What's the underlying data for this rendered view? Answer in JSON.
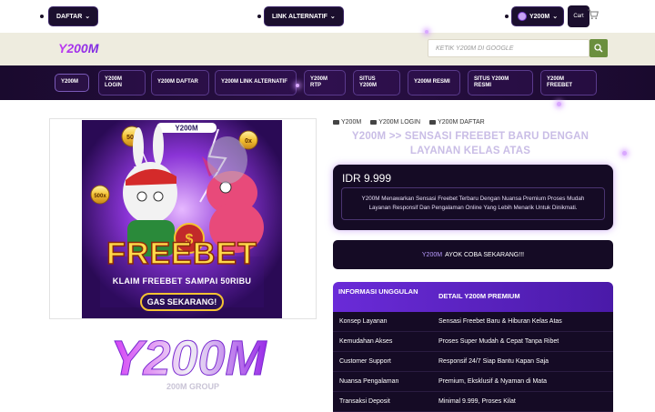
{
  "topbar": {
    "daftar_label": "DAFTAR",
    "link_alt_label": "LINK ALTERNATIF",
    "account_label": "Y200M",
    "cart_label": "Cart"
  },
  "header": {
    "logo_text": "Y200M",
    "search_placeholder": "KETIK Y200M DI GOOGLE"
  },
  "nav": {
    "items": [
      {
        "label": "Y200M"
      },
      {
        "label": "Y200M LOGIN"
      },
      {
        "label": "Y200M DAFTAR"
      },
      {
        "label": "Y200M LINK ALTERNATIF"
      },
      {
        "label": "Y200M RTP"
      },
      {
        "label": "SITUS Y200M"
      },
      {
        "label": "Y200M RESMI"
      },
      {
        "label": "SITUS Y200M RESMI"
      },
      {
        "label": "Y200M FREEBET"
      }
    ]
  },
  "banner": {
    "search_text": "Y200M",
    "multiplier_left": "50x",
    "multiplier_right": "0x",
    "multiplier_small": "500x",
    "title": "FREEBET",
    "subtitle": "KLAIM FREEBET SAMPAI 50RIBU",
    "cta": "GAS SEKARANG!"
  },
  "big_logo": {
    "text": "Y200M",
    "tagline": "200M GROUP"
  },
  "breadcrumbs": [
    "Y200M",
    "Y200M LOGIN",
    "Y200M DAFTAR"
  ],
  "headline": "Y200M >> SENSASI FREEBET BARU DENGAN LAYANAN KELAS ATAS",
  "price_card": {
    "price": "IDR 9.999",
    "description": "Y200M Menawarkan Sensasi Freebet Terbaru Dengan Nuansa Premium Proses Mudah Layanan Responsif Dan Pengalaman Online Yang Lebih Menarik Untuk Dinikmati."
  },
  "cta": {
    "brand": "Y200M",
    "text": "AYOK COBA SEKARANG!!!"
  },
  "info_table": {
    "header_left": "INFORMASI UNGGULAN",
    "header_right": "DETAIL Y200M PREMIUM",
    "rows": [
      {
        "label": "Konsep Layanan",
        "value": "Sensasi Freebet Baru & Hiburan Kelas Atas"
      },
      {
        "label": "Kemudahan Akses",
        "value": "Proses Super Mudah & Cepat Tanpa Ribet"
      },
      {
        "label": "Customer Support",
        "value": "Responsif 24/7 Siap Bantu Kapan Saja"
      },
      {
        "label": "Nuansa Pengalaman",
        "value": "Premium, Eksklusif & Nyaman di Mata"
      },
      {
        "label": "Transaksi Deposit",
        "value": "Minimal 9.999, Proses Kilat"
      }
    ]
  },
  "colors": {
    "dark_purple": "#150b25",
    "accent_purple": "#6a2bd8",
    "search_green": "#6b8f3e",
    "header_band": "#eeecdf"
  }
}
